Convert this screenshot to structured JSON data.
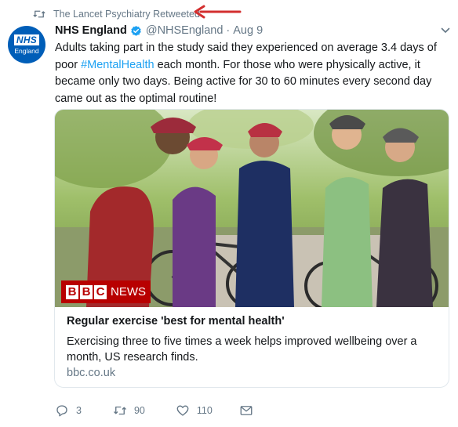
{
  "retweet": {
    "label": "The Lancet Psychiatry Retweeted",
    "icon": "retweet-icon"
  },
  "annotation": {
    "color": "#d32f2f",
    "icon": "red-arrow-icon"
  },
  "author": {
    "name": "NHS England",
    "handle": "@NHSEngland",
    "separator": "·",
    "date": "Aug 9",
    "verified_icon": "verified-badge-icon",
    "avatar": {
      "logo_text": "NHS",
      "subtext": "England",
      "color": "#005eb8"
    }
  },
  "tweet": {
    "text_before": "Adults taking part in the study said they experienced on average 3.4 days of poor ",
    "hashtag": "#MentalHealth",
    "text_after": " each month. For those who were physically active, it became only two days. Being active for 30 to 60 minutes every second day came out as the optimal routine!"
  },
  "card": {
    "logo_letters": [
      "B",
      "B",
      "C"
    ],
    "logo_news": "NEWS",
    "title": "Regular exercise 'best for mental health'",
    "description": "Exercising three to five times a week helps improved wellbeing over a month, US research finds.",
    "domain": "bbc.co.uk"
  },
  "actions": {
    "reply_count": "3",
    "retweet_count": "90",
    "like_count": "110",
    "icons": [
      "reply-icon",
      "retweet-icon",
      "heart-icon",
      "message-icon"
    ]
  },
  "colors": {
    "link": "#1da1f2",
    "muted": "#657786",
    "text": "#14171a",
    "border": "#e1e8ed"
  }
}
